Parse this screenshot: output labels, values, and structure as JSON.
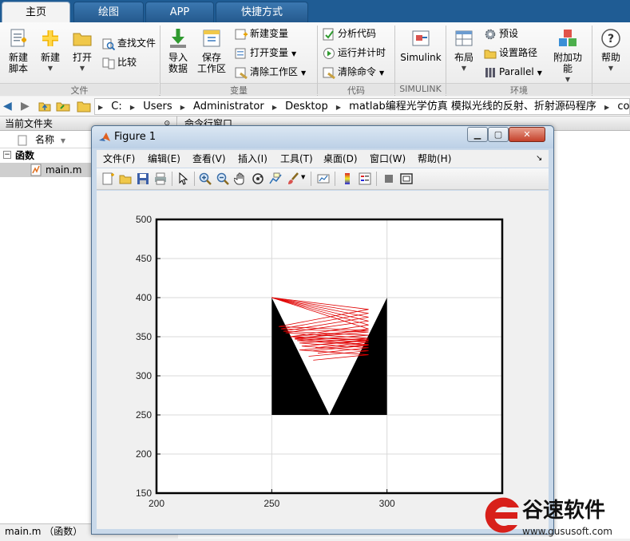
{
  "tabs": [
    "主页",
    "绘图",
    "APP",
    "快捷方式"
  ],
  "ribbon": {
    "file": {
      "new_script": "新建\n脚本",
      "new": "新建",
      "open": "打开",
      "find_files": "查找文件",
      "compare": "比较",
      "label": "文件"
    },
    "variable": {
      "import": "导入\n数据",
      "save_workspace": "保存\n工作区",
      "new_variable": "新建变量",
      "open_variable": "打开变量",
      "clear_workspace": "清除工作区",
      "label": "变量"
    },
    "code": {
      "analyze": "分析代码",
      "run_time": "运行并计时",
      "clear_commands": "清除命令",
      "label": "代码"
    },
    "simulink": {
      "button": "Simulink",
      "label": "SIMULINK"
    },
    "environment": {
      "layout": "布局",
      "preferences": "预设",
      "set_path": "设置路径",
      "parallel": "Parallel",
      "addons": "附加功能",
      "label": "环境"
    },
    "help": "帮助"
  },
  "address": {
    "path": [
      "C:",
      "Users",
      "Administrator",
      "Desktop",
      "matlab编程光学仿真 模拟光线的反射、折射源码程序",
      "code"
    ]
  },
  "current_folder": {
    "title": "当前文件夹",
    "column": "名称",
    "group": "函数",
    "file": "main.m",
    "status": "main.m （函数）"
  },
  "command_window": {
    "title": "命令行窗口"
  },
  "figure": {
    "title": "Figure 1",
    "menu": [
      "文件(F)",
      "编辑(E)",
      "查看(V)",
      "插入(I)",
      "工具(T)",
      "桌面(D)",
      "窗口(W)",
      "帮助(H)"
    ]
  },
  "chart_data": {
    "type": "line",
    "title": "",
    "xlabel": "",
    "ylabel": "",
    "xlim": [
      200,
      350
    ],
    "ylim": [
      150,
      500
    ],
    "xticks": [
      200,
      250,
      300,
      350
    ],
    "yticks": [
      150,
      200,
      250,
      300,
      350,
      400,
      450,
      500
    ],
    "grid": true,
    "fill_polygons": [
      {
        "name": "left-prism",
        "color": "#000000",
        "points": [
          [
            250,
            400
          ],
          [
            250,
            250
          ],
          [
            275,
            250
          ]
        ]
      },
      {
        "name": "right-prism",
        "color": "#000000",
        "points": [
          [
            300,
            400
          ],
          [
            300,
            250
          ],
          [
            275,
            250
          ]
        ]
      }
    ],
    "ray_color": "#e00000",
    "rays": [
      [
        [
          250,
          400
        ],
        [
          292,
          360
        ],
        [
          260,
          347
        ],
        [
          292,
          340
        ],
        [
          262,
          333
        ],
        [
          292,
          327
        ],
        [
          268,
          320
        ]
      ],
      [
        [
          250,
          400
        ],
        [
          292,
          365
        ],
        [
          258,
          350
        ],
        [
          292,
          345
        ],
        [
          263,
          338
        ],
        [
          292,
          332
        ],
        [
          266,
          325
        ]
      ],
      [
        [
          250,
          400
        ],
        [
          292,
          370
        ],
        [
          256,
          355
        ],
        [
          292,
          348
        ],
        [
          262,
          342
        ],
        [
          292,
          336
        ],
        [
          270,
          329
        ]
      ],
      [
        [
          250,
          400
        ],
        [
          292,
          375
        ],
        [
          255,
          357
        ],
        [
          292,
          352
        ],
        [
          261,
          345
        ],
        [
          292,
          339
        ],
        [
          268,
          332
        ]
      ],
      [
        [
          250,
          400
        ],
        [
          292,
          380
        ],
        [
          254,
          360
        ],
        [
          292,
          356
        ],
        [
          260,
          348
        ],
        [
          292,
          343
        ],
        [
          269,
          336
        ]
      ],
      [
        [
          250,
          400
        ],
        [
          292,
          385
        ],
        [
          253,
          363
        ],
        [
          292,
          358
        ],
        [
          258,
          350
        ],
        [
          292,
          346
        ],
        [
          267,
          339
        ]
      ]
    ]
  },
  "watermark": {
    "brand": "谷速软件",
    "url": "www.gususoft.com",
    "color": "#d8201a"
  }
}
